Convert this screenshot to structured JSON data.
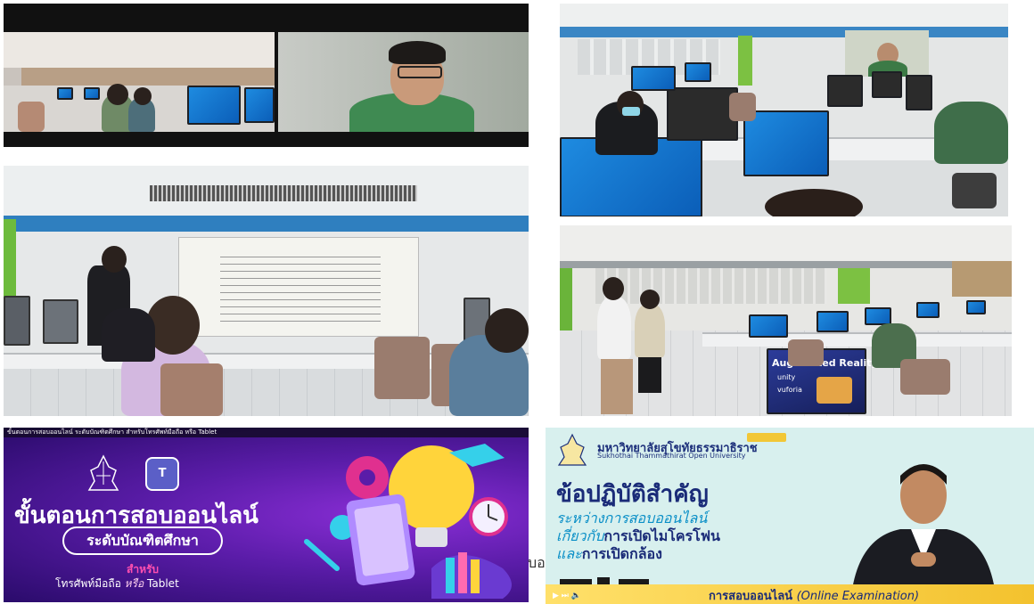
{
  "photos": {
    "video_call": {
      "kind": "photo"
    },
    "lecture": {
      "kind": "photo"
    },
    "lab_top": {
      "kind": "photo"
    },
    "lab_ar": {
      "kind": "photo",
      "screen_text": "Augmented Reality",
      "unity": "unity",
      "vuforia": "vuforia"
    }
  },
  "banner_purple": {
    "topbar": "ขั้นตอนการสอบออนไลน์ ระดับบัณฑิตศึกษา สำหรับโทรศัพท์มือถือ หรือ Tablet",
    "teams": "T",
    "heading": "ขั้นตอนการสอบออนไลน์",
    "pill": "ระดับบัณฑิตศึกษา",
    "for": "สำหรับ",
    "device_a": "โทรศัพท์มือถือ ",
    "device_or": "หรือ",
    "device_b": " Tablet"
  },
  "banner_green": {
    "uni_th": "มหาวิทยาลัยสุโขทัยธรรมาธิราช",
    "uni_en": "Sukhothai Thammathirat Open University",
    "title": "ข้อปฏิบัติสำคัญ",
    "line1": "ระหว่างการสอบออนไลน์",
    "line2a": "เกี่ยวกับ",
    "line2b": "การเปิดไมโครโฟน",
    "line3a": "และ",
    "line3b": "การเปิดกล้อง",
    "bottom_th": "การสอบออนไลน์ ",
    "bottom_en": "(Online Examination)"
  },
  "overlap_text": "บอ"
}
